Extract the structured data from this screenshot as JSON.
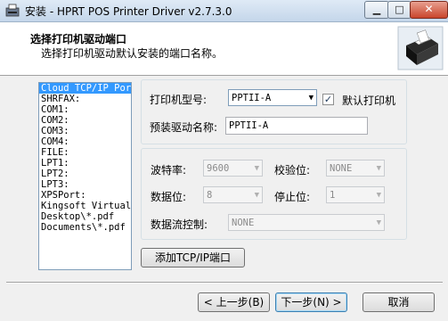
{
  "window": {
    "title": "安装 - HPRT POS Printer Driver v2.7.3.0",
    "min_symbol": "▁",
    "max_symbol": "□",
    "close_symbol": "✕"
  },
  "header": {
    "title": "选择打印机驱动端口",
    "subtitle": "选择打印机驱动默认安装的端口名称。"
  },
  "ports": [
    "Cloud TCP/IP Por",
    "SHRFAX:",
    "COM1:",
    "COM2:",
    "COM3:",
    "COM4:",
    "FILE:",
    "LPT1:",
    "LPT2:",
    "LPT3:",
    "XPSPort:",
    "Kingsoft Virtual",
    "Desktop\\*.pdf",
    "Documents\\*.pdf"
  ],
  "selected_port_index": 0,
  "printer": {
    "model_label": "打印机型号:",
    "model_value": "PPTII-A",
    "default_checked": true,
    "default_check_mark": "✓",
    "default_label": "默认打印机",
    "driver_name_label": "预装驱动名称:",
    "driver_name_value": "PPTII-A"
  },
  "serial": {
    "baud_label": "波特率:",
    "baud_value": "9600",
    "parity_label": "校验位:",
    "parity_value": "NONE",
    "databits_label": "数据位:",
    "databits_value": "8",
    "stopbits_label": "停止位:",
    "stopbits_value": "1",
    "flow_label": "数据流控制:",
    "flow_value": "NONE"
  },
  "buttons": {
    "add_tcp": "添加TCP/IP端口",
    "back": "< 上一步(B)",
    "next": "下一步(N) >",
    "cancel": "取消"
  },
  "dropdown_arrow": "▼"
}
